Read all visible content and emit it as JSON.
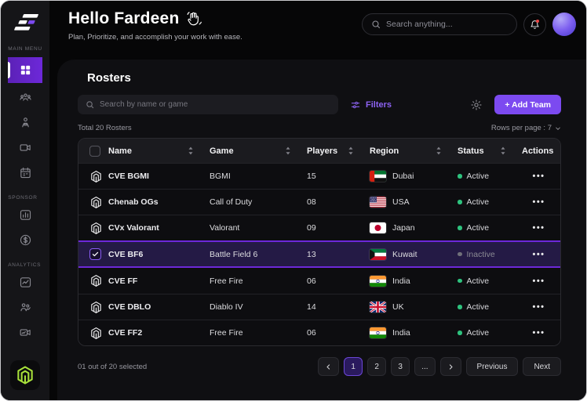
{
  "sidebar": {
    "sections": [
      {
        "label": "MAIN MENU",
        "items": [
          {
            "id": "dashboard",
            "icon": "dashboard-icon",
            "active": true
          },
          {
            "id": "teams",
            "icon": "teams-icon",
            "active": false
          },
          {
            "id": "players",
            "icon": "player-icon",
            "active": false
          },
          {
            "id": "media",
            "icon": "video-icon",
            "active": false
          },
          {
            "id": "schedule",
            "icon": "calendar-icon",
            "active": false
          }
        ]
      },
      {
        "label": "SPONSOR",
        "items": [
          {
            "id": "sponsor-stats",
            "icon": "bar-chart-icon",
            "active": false
          },
          {
            "id": "earnings",
            "icon": "coin-icon",
            "active": false
          }
        ]
      },
      {
        "label": "ANALYTICS",
        "items": [
          {
            "id": "performance",
            "icon": "line-chart-icon",
            "active": false
          },
          {
            "id": "team-analytics",
            "icon": "team-stats-icon",
            "active": false
          },
          {
            "id": "media-analytics",
            "icon": "video-stats-icon",
            "active": false
          }
        ]
      }
    ]
  },
  "header": {
    "greeting": "Hello Fardeen",
    "subtitle": "Plan, Prioritize, and accomplish your work with ease.",
    "search_placeholder": "Search anything..."
  },
  "toolbar": {
    "title": "Rosters",
    "search_placeholder": "Search by name or game",
    "filters_label": "Filters",
    "add_team_label": "+  Add Team"
  },
  "table": {
    "summary": "Total 20 Rosters",
    "rows_per_page_label": "Rows per page : 7",
    "columns": [
      {
        "label": "Name",
        "sortable": true
      },
      {
        "label": "Game",
        "sortable": true
      },
      {
        "label": "Players",
        "sortable": true
      },
      {
        "label": "Region",
        "sortable": true
      },
      {
        "label": "Status",
        "sortable": true
      },
      {
        "label": "Actions",
        "sortable": false
      }
    ],
    "rows": [
      {
        "name": "CVE BGMI",
        "game": "BGMI",
        "players": "15",
        "region": "Dubai",
        "flag": "uae",
        "status": "Active",
        "selected": false
      },
      {
        "name": "Chenab OGs",
        "game": "Call of Duty",
        "players": "08",
        "region": "USA",
        "flag": "usa",
        "status": "Active",
        "selected": false
      },
      {
        "name": "CVx Valorant",
        "game": "Valorant",
        "players": "09",
        "region": "Japan",
        "flag": "japan",
        "status": "Active",
        "selected": false
      },
      {
        "name": "CVE BF6",
        "game": "Battle Field 6",
        "players": "13",
        "region": "Kuwait",
        "flag": "kuwait",
        "status": "Inactive",
        "selected": true
      },
      {
        "name": "CVE FF",
        "game": "Free Fire",
        "players": "06",
        "region": "India",
        "flag": "india",
        "status": "Active",
        "selected": false
      },
      {
        "name": "CVE DBLO",
        "game": "Diablo IV",
        "players": "14",
        "region": "UK",
        "flag": "uk",
        "status": "Active",
        "selected": false
      },
      {
        "name": "CVE FF2",
        "game": "Free Fire",
        "players": "06",
        "region": "India",
        "flag": "india",
        "status": "Active",
        "selected": false
      }
    ],
    "actions_glyph": "•••"
  },
  "footer": {
    "selection_text": "01 out of 20 selected",
    "pagination": [
      {
        "label": "‹",
        "kind": "arrow-left",
        "name": "page-prev-arrow",
        "active": false
      },
      {
        "label": "1",
        "kind": "page",
        "name": "page-1",
        "active": true
      },
      {
        "label": "2",
        "kind": "page",
        "name": "page-2",
        "active": false
      },
      {
        "label": "3",
        "kind": "page",
        "name": "page-3",
        "active": false
      },
      {
        "label": "...",
        "kind": "ellipsis",
        "name": "page-ellipsis",
        "active": false
      },
      {
        "label": "›",
        "kind": "arrow-right",
        "name": "page-next-arrow",
        "active": false
      },
      {
        "label": "Previous",
        "kind": "wide",
        "name": "previous-button",
        "active": false
      },
      {
        "label": "Next",
        "kind": "wide",
        "name": "next-button",
        "active": false
      }
    ]
  },
  "colors": {
    "accent_purple": "#7c4af0",
    "sidebar_active_purple": "#6d28d9",
    "active_green": "#2ec27e",
    "inactive_gray": "#70707a",
    "brand_lime": "#a8e13a",
    "notification_red": "#ef4444"
  }
}
